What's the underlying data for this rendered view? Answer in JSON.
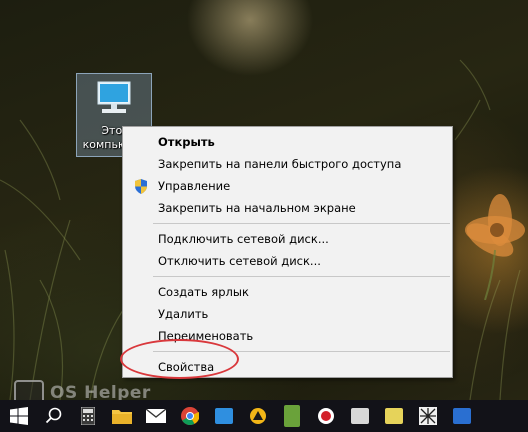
{
  "desktop": {
    "icon_label": "Этот\nкомпьютер"
  },
  "context_menu": {
    "items": [
      {
        "label": "Открыть",
        "bold": true
      },
      {
        "label": "Закрепить на панели быстрого доступа"
      },
      {
        "label": "Управление",
        "icon": "uac-shield-icon"
      },
      {
        "label": "Закрепить на начальном экране"
      },
      {
        "label": "Подключить сетевой диск..."
      },
      {
        "label": "Отключить сетевой диск..."
      },
      {
        "label": "Создать ярлык"
      },
      {
        "label": "Удалить"
      },
      {
        "label": "Переименовать"
      },
      {
        "label": "Свойства",
        "highlighted": true
      }
    ]
  },
  "watermark": {
    "text": "OS Helper"
  },
  "taskbar": {
    "items": [
      "windows-start-icon",
      "search-icon",
      "calculator-icon",
      "file-explorer-icon",
      "mail-icon",
      "chrome-icon",
      "app-store-icon",
      "aimp-icon",
      "game-icon",
      "record-icon",
      "game-icon-2",
      "notepad-icon",
      "network-icon",
      "app-icon"
    ]
  },
  "colors": {
    "menu_bg": "#f2f2f2",
    "highlight_ellipse": "#d9383c",
    "taskbar_bg": "#121218"
  }
}
